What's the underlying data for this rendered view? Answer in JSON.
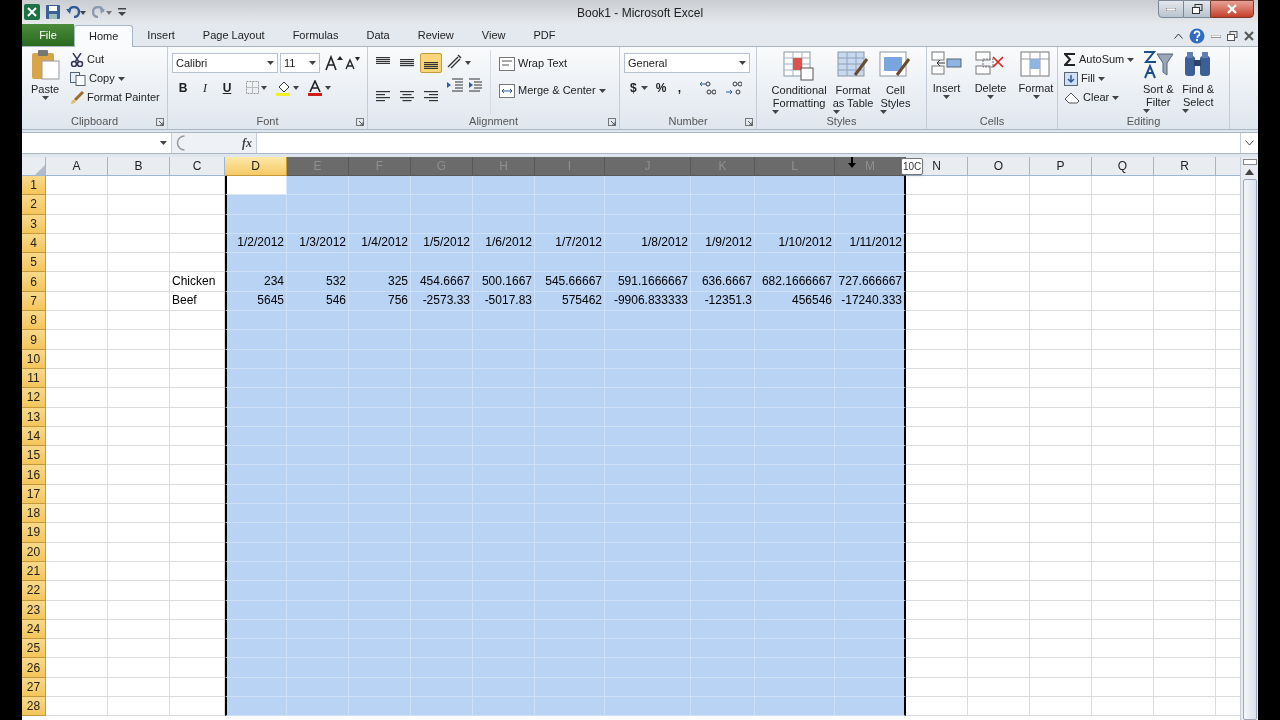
{
  "window": {
    "title": "Book1 - Microsoft Excel"
  },
  "tabs": [
    {
      "label": "File",
      "kind": "file",
      "selected": false
    },
    {
      "label": "Home",
      "kind": "tab",
      "selected": true
    },
    {
      "label": "Insert",
      "kind": "tab",
      "selected": false
    },
    {
      "label": "Page Layout",
      "kind": "tab",
      "selected": false
    },
    {
      "label": "Formulas",
      "kind": "tab",
      "selected": false
    },
    {
      "label": "Data",
      "kind": "tab",
      "selected": false
    },
    {
      "label": "Review",
      "kind": "tab",
      "selected": false
    },
    {
      "label": "View",
      "kind": "tab",
      "selected": false
    },
    {
      "label": "PDF",
      "kind": "tab",
      "selected": false
    }
  ],
  "ribbon": {
    "clipboard": {
      "label": "Clipboard",
      "paste": "Paste",
      "cut": "Cut",
      "copy": "Copy",
      "format_painter": "Format Painter"
    },
    "font": {
      "label": "Font",
      "font_name": "Calibri",
      "font_size": "11",
      "bold": "B",
      "italic": "I",
      "underline": "U"
    },
    "alignment": {
      "label": "Alignment",
      "wrap_text": "Wrap Text",
      "merge_center": "Merge & Center",
      "bottom_align_selected": true
    },
    "number": {
      "label": "Number",
      "format": "General",
      "currency": "$",
      "percent": "%",
      "comma": ","
    },
    "styles": {
      "label": "Styles",
      "buttons": [
        {
          "lines": [
            "Conditional",
            "Formatting"
          ]
        },
        {
          "lines": [
            "Format",
            "as Table"
          ]
        },
        {
          "lines": [
            "Cell",
            "Styles"
          ]
        }
      ]
    },
    "cells": {
      "label": "Cells",
      "buttons": [
        "Insert",
        "Delete",
        "Format"
      ]
    },
    "editing": {
      "label": "Editing",
      "autosum": "AutoSum",
      "fill": "Fill",
      "clear": "Clear",
      "buttons": [
        {
          "lines": [
            "Sort &",
            "Filter"
          ]
        },
        {
          "lines": [
            "Find &",
            "Select"
          ]
        }
      ]
    }
  },
  "formula_bar": {
    "function_label": "fx"
  },
  "tooltip": "10C",
  "columns": [
    {
      "label": "A",
      "selected": false,
      "active": false
    },
    {
      "label": "B",
      "selected": false,
      "active": false
    },
    {
      "label": "C",
      "selected": false,
      "active": false
    },
    {
      "label": "D",
      "selected": true,
      "active": true
    },
    {
      "label": "E",
      "selected": true,
      "active": false
    },
    {
      "label": "F",
      "selected": true,
      "active": false
    },
    {
      "label": "G",
      "selected": true,
      "active": false
    },
    {
      "label": "H",
      "selected": true,
      "active": false
    },
    {
      "label": "I",
      "selected": true,
      "active": false
    },
    {
      "label": "J",
      "selected": true,
      "active": false
    },
    {
      "label": "K",
      "selected": true,
      "active": false
    },
    {
      "label": "L",
      "selected": true,
      "active": false
    },
    {
      "label": "M",
      "selected": true,
      "active": false
    },
    {
      "label": "N",
      "selected": false,
      "active": false
    },
    {
      "label": "O",
      "selected": false,
      "active": false
    },
    {
      "label": "P",
      "selected": false,
      "active": false
    },
    {
      "label": "Q",
      "selected": false,
      "active": false
    },
    {
      "label": "R",
      "selected": false,
      "active": false
    }
  ],
  "rows": [
    {
      "header": "1",
      "selected": true
    },
    {
      "header": "2",
      "selected": true
    },
    {
      "header": "3",
      "selected": true
    },
    {
      "header": "4",
      "selected": true,
      "cells": [
        {
          "kind": "empty"
        },
        {
          "kind": "empty"
        },
        {
          "kind": "empty"
        },
        {
          "text": "1/2/2012",
          "kind": "number"
        },
        {
          "text": "1/3/2012",
          "kind": "number"
        },
        {
          "text": "1/4/2012",
          "kind": "number"
        },
        {
          "text": "1/5/2012",
          "kind": "number"
        },
        {
          "text": "1/6/2012",
          "kind": "number"
        },
        {
          "text": "1/7/2012",
          "kind": "number"
        },
        {
          "text": "1/8/2012",
          "kind": "number"
        },
        {
          "text": "1/9/2012",
          "kind": "number"
        },
        {
          "text": "1/10/2012",
          "kind": "number"
        },
        {
          "text": "1/11/2012",
          "kind": "number"
        }
      ]
    },
    {
      "header": "5",
      "selected": true
    },
    {
      "header": "6",
      "selected": true,
      "cells": [
        {
          "kind": "empty"
        },
        {
          "kind": "empty"
        },
        {
          "text": "Chicken",
          "kind": "text"
        },
        {
          "text": "234",
          "kind": "number"
        },
        {
          "text": "532",
          "kind": "number"
        },
        {
          "text": "325",
          "kind": "number"
        },
        {
          "text": "454.6667",
          "kind": "number"
        },
        {
          "text": "500.1667",
          "kind": "number"
        },
        {
          "text": "545.66667",
          "kind": "number"
        },
        {
          "text": "591.1666667",
          "kind": "number"
        },
        {
          "text": "636.6667",
          "kind": "number"
        },
        {
          "text": "682.1666667",
          "kind": "number"
        },
        {
          "text": "727.666667",
          "kind": "number"
        }
      ]
    },
    {
      "header": "7",
      "selected": true,
      "cells": [
        {
          "kind": "empty"
        },
        {
          "kind": "empty"
        },
        {
          "text": "Beef",
          "kind": "text"
        },
        {
          "text": "5645",
          "kind": "number"
        },
        {
          "text": "546",
          "kind": "number"
        },
        {
          "text": "756",
          "kind": "number"
        },
        {
          "text": "-2573.33",
          "kind": "number"
        },
        {
          "text": "-5017.83",
          "kind": "number"
        },
        {
          "text": "575462",
          "kind": "number"
        },
        {
          "text": "-9906.833333",
          "kind": "number"
        },
        {
          "text": "-12351.3",
          "kind": "number"
        },
        {
          "text": "456546",
          "kind": "number"
        },
        {
          "text": "-17240.333",
          "kind": "number"
        }
      ]
    },
    {
      "header": "8",
      "selected": true
    },
    {
      "header": "9",
      "selected": true
    },
    {
      "header": "10",
      "selected": true
    },
    {
      "header": "11",
      "selected": true
    },
    {
      "header": "12",
      "selected": true
    },
    {
      "header": "13",
      "selected": true
    },
    {
      "header": "14",
      "selected": true
    },
    {
      "header": "15",
      "selected": true
    },
    {
      "header": "16",
      "selected": true
    },
    {
      "header": "17",
      "selected": true
    },
    {
      "header": "18",
      "selected": true
    },
    {
      "header": "19",
      "selected": true
    },
    {
      "header": "20",
      "selected": true
    },
    {
      "header": "21",
      "selected": true
    },
    {
      "header": "22",
      "selected": true
    },
    {
      "header": "23",
      "selected": true
    },
    {
      "header": "24",
      "selected": true
    },
    {
      "header": "25",
      "selected": true
    },
    {
      "header": "26",
      "selected": true
    },
    {
      "header": "27",
      "selected": true
    },
    {
      "header": "28",
      "selected": true
    }
  ]
}
